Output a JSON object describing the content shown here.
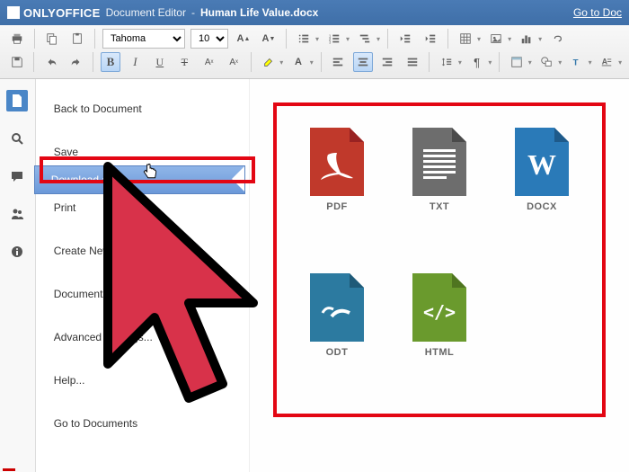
{
  "titlebar": {
    "brand": "ONLYOFFICE",
    "editor": "Document Editor",
    "separator": "-",
    "docname": "Human Life Value.docx",
    "golink": "Go to Doc"
  },
  "toolbar": {
    "font_name": "Tahoma",
    "font_size": "10"
  },
  "leftbar": {
    "icons": [
      "file-icon",
      "search-icon",
      "comment-icon",
      "users-icon",
      "info-icon"
    ]
  },
  "filemenu": {
    "items": [
      {
        "label": "Back to Document"
      },
      {
        "label": "Save"
      },
      {
        "label": "Download as...",
        "selected": true
      },
      {
        "label": "Print"
      },
      {
        "label": "Create New"
      },
      {
        "label": "Document Info..."
      },
      {
        "label": "Advanced Settings..."
      },
      {
        "label": "Help..."
      },
      {
        "label": "Go to Documents"
      }
    ]
  },
  "formats": [
    {
      "label": "PDF",
      "color": "#c0392b",
      "icon": "pdf"
    },
    {
      "label": "TXT",
      "color": "#6d6d6d",
      "icon": "txt"
    },
    {
      "label": "DOCX",
      "color": "#2a7ab8",
      "icon": "docx"
    },
    {
      "label": "ODT",
      "color": "#2c7aa0",
      "icon": "odt"
    },
    {
      "label": "HTML",
      "color": "#6a9a2d",
      "icon": "html"
    }
  ],
  "colors": {
    "accent": "#4a86c7",
    "highlight": "#e30613",
    "cursor_fill": "#d8324a"
  }
}
